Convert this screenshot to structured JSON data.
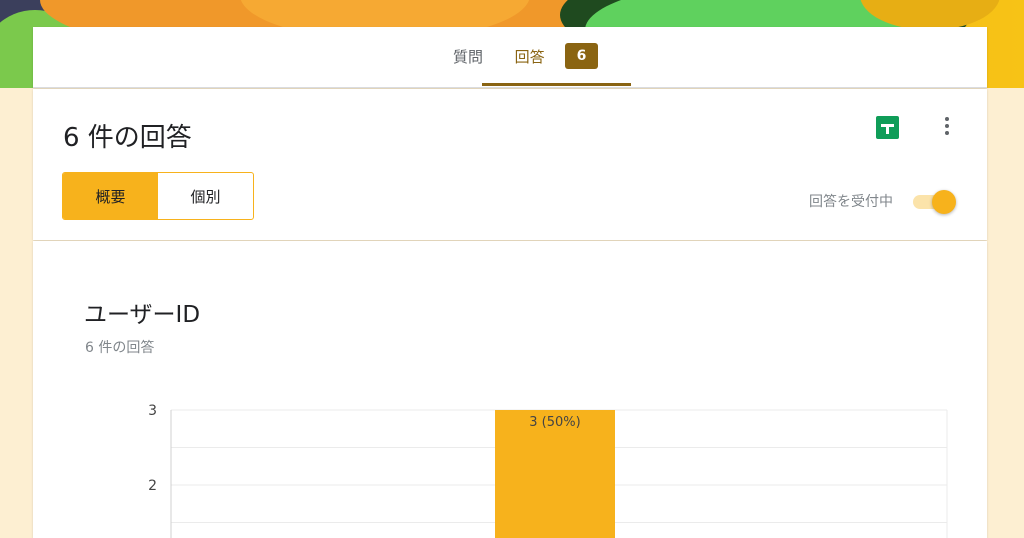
{
  "header": {
    "tabs": [
      {
        "label": "質問"
      },
      {
        "label": "回答",
        "badge": "6"
      }
    ]
  },
  "summary": {
    "title": "6 件の回答",
    "segments": [
      "概要",
      "個別"
    ],
    "accepting_label": "回答を受付中",
    "accepting": true
  },
  "question": {
    "title": "ユーザーID",
    "count_text": "6 件の回答"
  },
  "colors": {
    "accent": "#f7b21c",
    "tab_active": "#8a6412",
    "sheets_green": "#0f9d58"
  },
  "chart_data": {
    "type": "bar",
    "categories": [
      "",
      "",
      ""
    ],
    "values": [
      null,
      3,
      null
    ],
    "bar_labels": [
      "",
      "3 (50%)",
      ""
    ],
    "y_ticks": [
      "3",
      "2"
    ],
    "ylim": [
      0,
      3
    ],
    "grid": true,
    "color": "#f7b21c"
  }
}
